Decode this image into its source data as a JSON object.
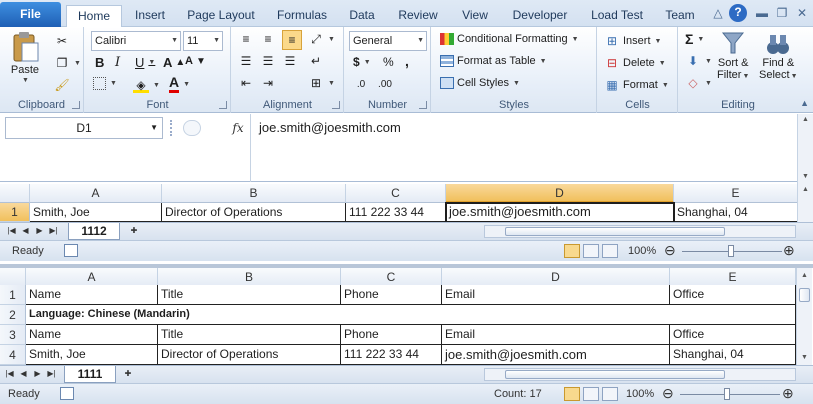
{
  "ribbon_tabs": [
    "File",
    "Home",
    "Insert",
    "Page Layout",
    "Formulas",
    "Data",
    "Review",
    "View",
    "Developer",
    "Load Test",
    "Team"
  ],
  "clipboard": {
    "paste": "Paste",
    "label": "Clipboard"
  },
  "font": {
    "name": "Calibri",
    "size": "11",
    "label": "Font"
  },
  "alignment": {
    "label": "Alignment"
  },
  "number": {
    "format": "General",
    "label": "Number",
    "pct": "%",
    "comma": ","
  },
  "styles": {
    "conditional": "Conditional Formatting",
    "table": "Format as Table",
    "cell": "Cell Styles",
    "label": "Styles"
  },
  "cells": {
    "insert": "Insert",
    "delete": "Delete",
    "format": "Format",
    "label": "Cells"
  },
  "editing": {
    "sort": "Sort &",
    "sort2": "Filter",
    "find": "Find &",
    "find2": "Select",
    "label": "Editing"
  },
  "formula_bar": {
    "name_box": "D1",
    "fx": "fx",
    "content": "joe.smith@joesmith.com"
  },
  "top_sheet": {
    "columns": [
      "A",
      "B",
      "C",
      "D",
      "E"
    ],
    "rows": [
      {
        "num": "1",
        "cells": [
          "Smith, Joe",
          "Director of Operations",
          "111 222 33 44",
          "joe.smith@joesmith.com",
          "Shanghai, 04"
        ]
      }
    ],
    "tab": "1112",
    "status": "Ready",
    "zoom": "100%"
  },
  "bottom_sheet": {
    "columns": [
      "A",
      "B",
      "C",
      "D",
      "E"
    ],
    "rows": [
      {
        "num": "1",
        "cells": [
          "Name",
          "Title",
          "Phone",
          "Email",
          "Office"
        ]
      },
      {
        "num": "2",
        "merged": "Language: Chinese (Mandarin)"
      },
      {
        "num": "3",
        "cells": [
          "Name",
          "Title",
          "Phone",
          "Email",
          "Office"
        ]
      },
      {
        "num": "4",
        "cells": [
          "Smith, Joe",
          "Director of Operations",
          "111 222 33 44",
          "joe.smith@joesmith.com",
          "Shanghai, 04"
        ]
      }
    ],
    "tab": "1111",
    "status": "Ready",
    "count": "Count: 17",
    "zoom": "100%"
  }
}
